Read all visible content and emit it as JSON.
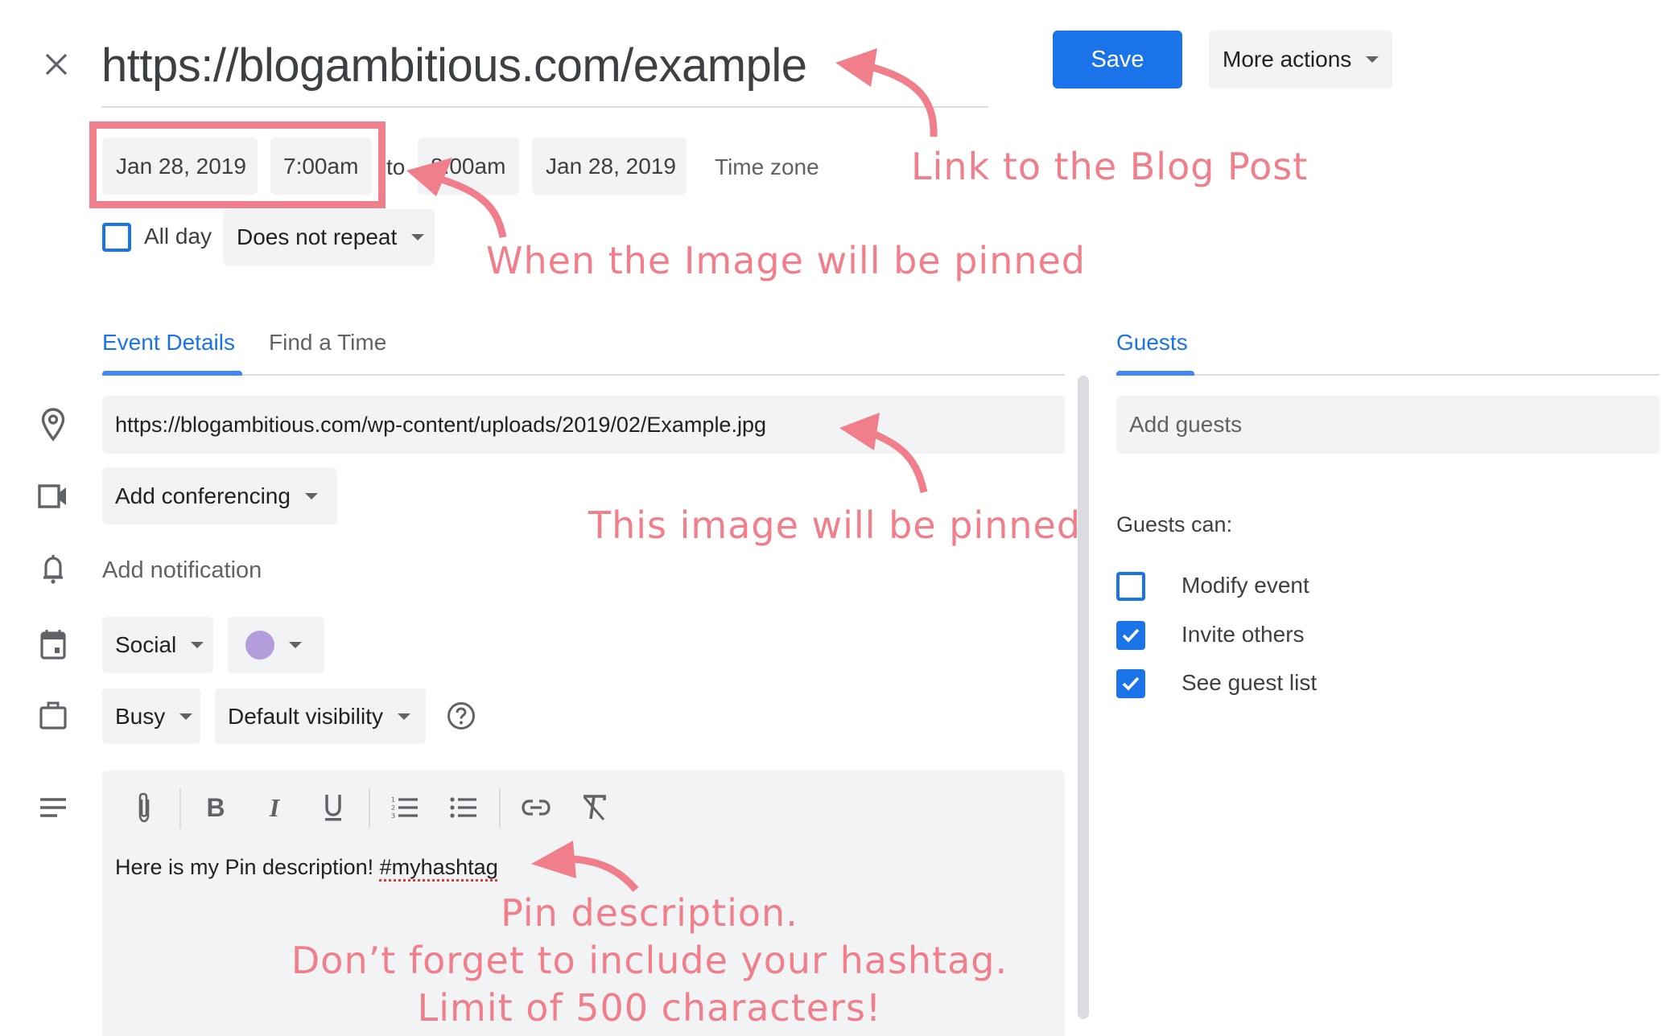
{
  "header": {
    "title": "https://blogambitious.com/example",
    "save_label": "Save",
    "more_actions_label": "More actions"
  },
  "datetime": {
    "start_date": "Jan 28, 2019",
    "start_time": "7:00am",
    "to_label": "to",
    "end_time": "8:00am",
    "end_date": "Jan 28, 2019",
    "timezone_label": "Time zone",
    "all_day_label": "All day",
    "all_day_checked": false,
    "repeat_value": "Does not repeat"
  },
  "tabs": {
    "event_details": "Event Details",
    "find_a_time": "Find a Time",
    "guests": "Guests"
  },
  "details": {
    "location_value": "https://blogambitious.com/wp-content/uploads/2019/02/Example.jpg",
    "conferencing_label": "Add conferencing",
    "notification_label": "Add notification",
    "calendar_value": "Social",
    "event_color": "#b39ddb",
    "availability_value": "Busy",
    "visibility_value": "Default visibility",
    "description_text": "Here is my Pin description! ",
    "description_hashtag": "#myhashtag",
    "toolbar": [
      "attach-file",
      "bold",
      "italic",
      "underline",
      "numbered-list",
      "bulleted-list",
      "link",
      "remove-formatting"
    ]
  },
  "guests": {
    "add_guests_placeholder": "Add guests",
    "guests_can_label": "Guests can:",
    "permissions": [
      {
        "label": "Modify event",
        "checked": false
      },
      {
        "label": "Invite others",
        "checked": true
      },
      {
        "label": "See guest list",
        "checked": true
      }
    ]
  },
  "annotations": {
    "link": "Link to the Blog Post",
    "when": "When the Image will be pinned",
    "image": "This image will be pinned",
    "desc_line1": "Pin description.",
    "desc_line2": "Don’t forget to include your hashtag.",
    "desc_line3": "Limit of 500 characters!"
  },
  "colors": {
    "accent": "#1a73e8",
    "annotation": "#f07f8b",
    "chip_bg": "#f1f3f4"
  }
}
